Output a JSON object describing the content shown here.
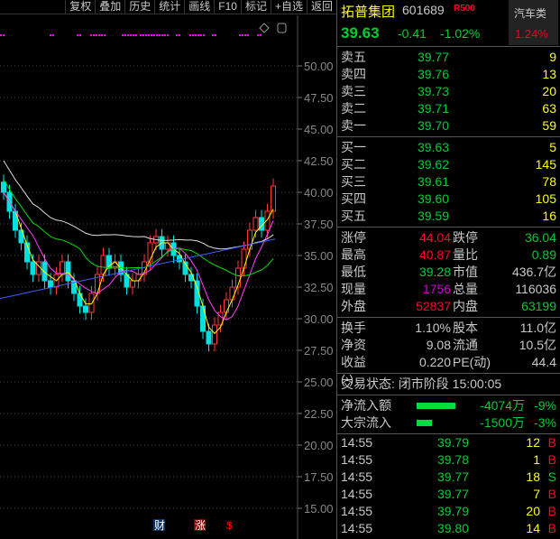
{
  "toolbar": [
    "复权",
    "叠加",
    "历史",
    "统计",
    "画线",
    "F10",
    "标记",
    "+自选",
    "返回"
  ],
  "stock": {
    "name": "拓普集团",
    "code": "601689",
    "badge": "R500",
    "price": "39.63",
    "change": "-0.41",
    "change_pct": "-1.02%",
    "sector": "汽车类",
    "sector_pct": "1.24%"
  },
  "asks": [
    {
      "label": "卖五",
      "price": "39.77",
      "vol": "9"
    },
    {
      "label": "卖四",
      "price": "39.76",
      "vol": "13"
    },
    {
      "label": "卖三",
      "price": "39.73",
      "vol": "20"
    },
    {
      "label": "卖二",
      "price": "39.71",
      "vol": "63"
    },
    {
      "label": "卖一",
      "price": "39.70",
      "vol": "59"
    }
  ],
  "bids": [
    {
      "label": "买一",
      "price": "39.63",
      "vol": "5"
    },
    {
      "label": "买二",
      "price": "39.62",
      "vol": "145"
    },
    {
      "label": "买三",
      "price": "39.61",
      "vol": "78"
    },
    {
      "label": "买四",
      "price": "39.60",
      "vol": "105"
    },
    {
      "label": "买五",
      "price": "39.59",
      "vol": "16"
    }
  ],
  "quote": [
    {
      "l1": "涨停",
      "v1": "44.04",
      "c1": "rd",
      "l2": "跌停",
      "v2": "36.04",
      "c2": "g"
    },
    {
      "l1": "最高",
      "v1": "40.87",
      "c1": "rd",
      "l2": "量比",
      "v2": "0.89",
      "c2": "g"
    },
    {
      "l1": "最低",
      "v1": "39.28",
      "c1": "g",
      "l2": "市值",
      "v2": "436.7亿",
      "c2": "w"
    },
    {
      "l1": "现量",
      "v1": "1756",
      "c1": "m",
      "l2": "总量",
      "v2": "116036",
      "c2": "w"
    },
    {
      "l1": "外盘",
      "v1": "52837",
      "c1": "rd",
      "l2": "内盘",
      "v2": "63199",
      "c2": "g"
    }
  ],
  "fund": [
    {
      "l1": "换手",
      "v1": "1.10%",
      "l2": "股本",
      "v2": "11.0亿"
    },
    {
      "l1": "净资",
      "v1": "9.08",
      "l2": "流通",
      "v2": "10.5亿"
    },
    {
      "l1": "收益(-)",
      "v1": "0.220",
      "l2": "PE(动)",
      "v2": "44.4"
    }
  ],
  "status": "交易状态: 闭市阶段 15:00:05",
  "flows": [
    {
      "label": "净流入额",
      "amount": "-4074万",
      "pct": "-9%",
      "bar": 0.9
    },
    {
      "label": "大宗流入",
      "amount": "-1500万",
      "pct": "-3%",
      "bar": 0.35
    }
  ],
  "ticks": [
    {
      "time": "14:55",
      "price": "39.79",
      "vol": "12",
      "side": "B"
    },
    {
      "time": "14:55",
      "price": "39.78",
      "vol": "1",
      "side": "B"
    },
    {
      "time": "14:55",
      "price": "39.77",
      "vol": "18",
      "side": "S"
    },
    {
      "time": "14:55",
      "price": "39.77",
      "vol": "7",
      "side": "B"
    },
    {
      "time": "14:55",
      "price": "39.79",
      "vol": "20",
      "side": "B"
    },
    {
      "time": "14:55",
      "price": "39.80",
      "vol": "14",
      "side": "B"
    }
  ],
  "chart_data": {
    "type": "candlestick",
    "y_ticks": [
      "50.00",
      "47.50",
      "45.00",
      "42.50",
      "40.00",
      "37.50",
      "35.00",
      "32.50",
      "30.00",
      "27.50",
      "25.00",
      "22.50",
      "20.00",
      "17.50",
      "15.00"
    ],
    "closes": [
      40,
      38.5,
      37,
      36,
      34.5,
      33.5,
      34.5,
      33,
      32.5,
      33.5,
      34.5,
      33,
      32,
      31,
      30.5,
      32,
      33.5,
      35,
      34,
      34.5,
      33.5,
      32.5,
      33,
      33.5,
      34.5,
      36,
      36.5,
      35.5,
      36,
      35,
      34.5,
      33.5,
      33,
      31,
      29,
      28,
      29.5,
      30.5,
      31.5,
      32.5,
      34,
      35.5,
      37,
      38,
      37,
      38.5,
      40.5
    ],
    "markers": [
      "财",
      "涨",
      "$"
    ],
    "colors": {
      "up": "#ff3b3b",
      "down": "#00e0e0",
      "ma1": "#e0e0e0",
      "ma2": "#ffff00",
      "ma3": "#ff40ff",
      "ma4": "#00dd00",
      "trend": "#4060ff"
    }
  }
}
